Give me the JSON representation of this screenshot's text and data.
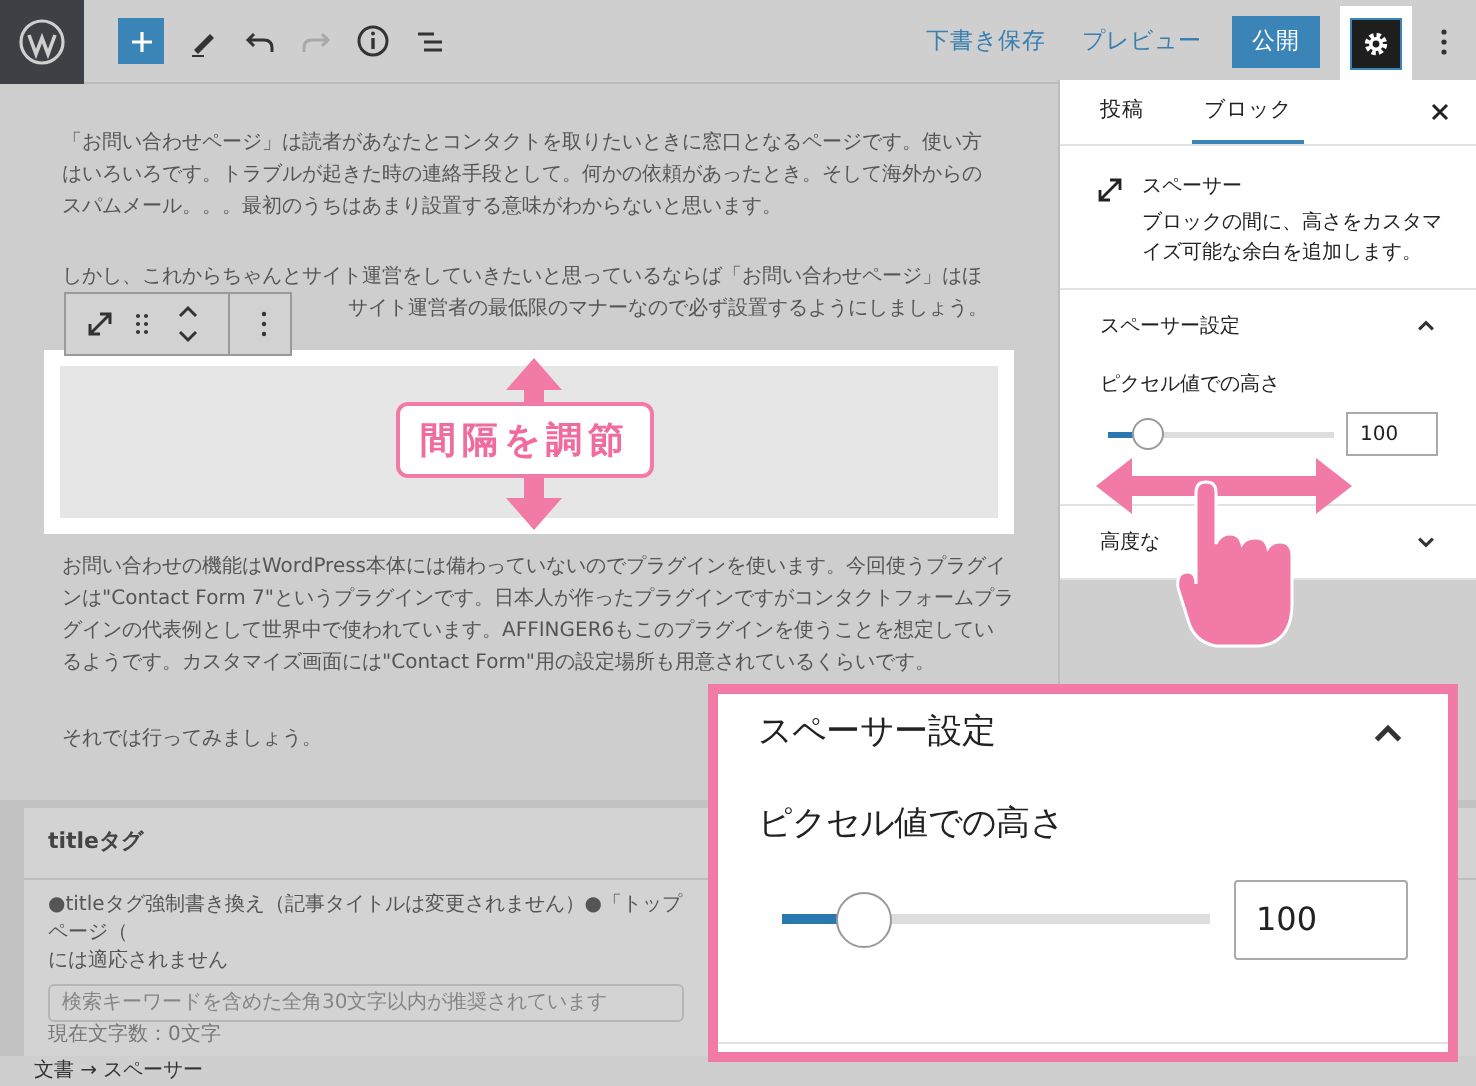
{
  "header": {
    "save_draft": "下書き保存",
    "preview": "プレビュー",
    "publish": "公開",
    "redo_disabled": true
  },
  "content": {
    "paragraphs": [
      {
        "lines": [
          "「お問い合わせページ」は読者があなたとコンタクトを取りたいときに窓口となるページです。使い方",
          "はいろいろです。トラブルが起きた時の連絡手段として。何かの依頼があったとき。そして海外からの",
          "スパムメール。。。最初のうちはあまり設置する意味がわからないと思います。"
        ]
      },
      {
        "lines": [
          "しかし、これからちゃんとサイト運営をしていきたいと思っているならば「お問い合わせページ」はほ",
          "サイト運営者の最低限のマナーなので必ず設置するようにしましょう。"
        ],
        "covered_start": true
      },
      {
        "lines": [
          "お問い合わせの機能はWordPress本体には備わっていないのでプラグインを使います。今回使うプラグイ",
          "ンは\"Contact Form 7\"というプラグインです。日本人が作ったプラグインですがコンタクトフォームプラ",
          "グインの代表例として世界中で使われています。AFFINGER6もこのプラグインを使うことを想定してい",
          "るようです。カスタマイズ画面には\"Contact Form\"用の設定場所も用意されているくらいです。"
        ]
      },
      {
        "lines": [
          "それでは行ってみましょう。"
        ]
      }
    ],
    "callout": "間隔を調節"
  },
  "seo_card": {
    "title": "titleタグ",
    "note_lines": [
      "●titleタグ強制書き換え（記事タイトルは変更されません）●「トップページ（",
      "には適応されません"
    ],
    "placeholder": "検索キーワードを含めた全角30文字以内が推奨されています",
    "count": "現在文字数：0文字"
  },
  "breadcrumb": "文書 → スペーサー",
  "sidebar": {
    "tabs": [
      {
        "label": "投稿",
        "selected": false
      },
      {
        "label": "ブロック",
        "selected": true
      }
    ],
    "block": {
      "title": "スペーサー",
      "description": "ブロックの間に、高さをカスタマイズ可能な余白を追加します。"
    },
    "sections": [
      {
        "title": "スペーサー設定",
        "expanded": true,
        "label": "ピクセル値での高さ",
        "level": 0.18,
        "value": "100"
      },
      {
        "title": "高度な",
        "expanded": false
      }
    ]
  },
  "zoom_panel": {
    "title": "スペーサー設定",
    "expanded": true,
    "label": "ピクセル値での高さ",
    "level": 0.19,
    "value": "100"
  }
}
